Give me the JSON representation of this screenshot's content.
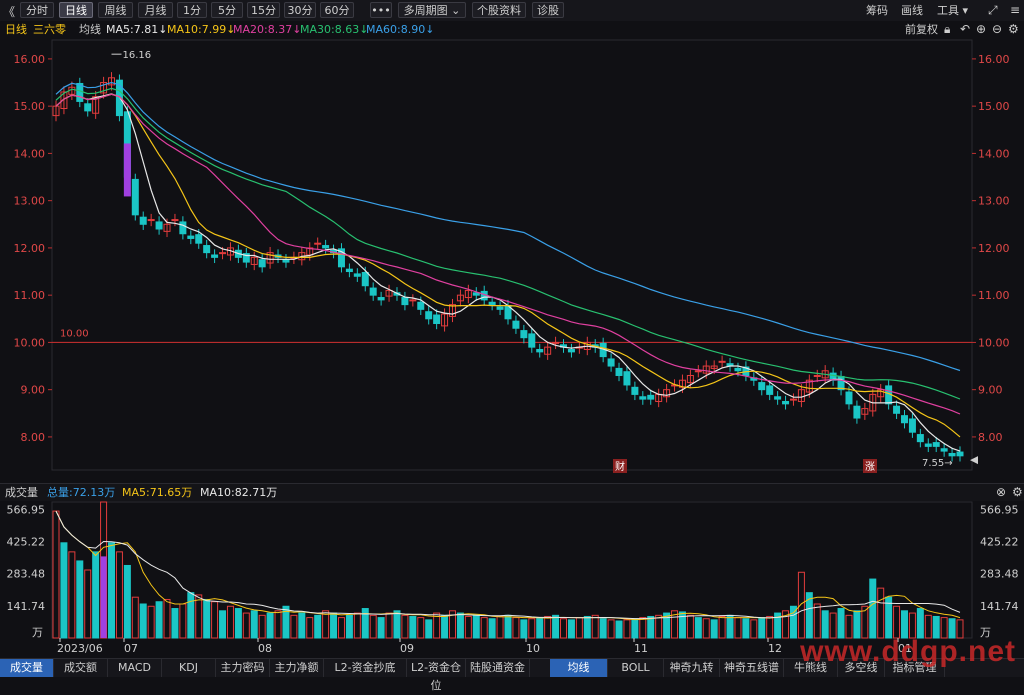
{
  "toolbar": {
    "collapse_icon": "《",
    "periods": [
      "分时",
      "日线",
      "周线",
      "月线",
      "1分",
      "5分",
      "15分",
      "30分",
      "60分",
      "•••",
      "多周期图 ⌄",
      "个股资料",
      "诊股"
    ],
    "active_period": "日线",
    "right": {
      "chips": "筹码",
      "draw": "画线",
      "tools": "工具 ▾"
    },
    "accent": "#2b63b5"
  },
  "stock": {
    "period_label": "日线",
    "name": "三六零",
    "ma_label": "均线",
    "ma": [
      {
        "name": "MA5",
        "value": "7.81",
        "color": "#e8e8e8"
      },
      {
        "name": "MA10",
        "value": "7.99",
        "color": "#f5c518"
      },
      {
        "name": "MA20",
        "value": "8.37",
        "color": "#e040a0"
      },
      {
        "name": "MA30",
        "value": "8.63",
        "color": "#28c070"
      },
      {
        "name": "MA60",
        "value": "8.90",
        "color": "#3aa0e8"
      }
    ],
    "adjust": "前复权"
  },
  "price_axis": {
    "ticks": [
      "16.00",
      "15.00",
      "14.00",
      "13.00",
      "12.00",
      "11.00",
      "10.00",
      "9.00",
      "8.00"
    ]
  },
  "annotations": {
    "high": "16.16",
    "low": "7.55",
    "line_value": "10.00",
    "marker_fin": "财",
    "marker_up": "涨"
  },
  "volume": {
    "title": "成交量",
    "total": "总量:72.13万",
    "ma5": "MA5:71.65万",
    "ma10": "MA10:82.71万",
    "ticks": [
      "566.95",
      "425.22",
      "283.48",
      "141.74",
      "万"
    ]
  },
  "x_axis": {
    "labels": [
      "2023/06",
      "07",
      "08",
      "09",
      "10",
      "11",
      "12",
      "01"
    ]
  },
  "bottom_tabs": [
    "成交量",
    "成交额",
    "MACD",
    "KDJ",
    "主力密码",
    "主力净额",
    "L2-资金抄底",
    "L2-资金仓位",
    "陆股通资金",
    "均线",
    "BOLL",
    "神奇九转",
    "神奇五线谱",
    "牛熊线",
    "多空线",
    "指标管理"
  ],
  "watermark": "www.ddgp.net",
  "chart_data": {
    "type": "line",
    "note_type": "candlestick",
    "up_color": "#e23c3c",
    "down_color": "#1bc6c6",
    "ylim": [
      7.3,
      16.4
    ],
    "close": [
      15.0,
      15.3,
      15.4,
      15.1,
      14.9,
      15.2,
      15.5,
      15.6,
      14.8,
      13.5,
      12.7,
      12.5,
      12.6,
      12.4,
      12.5,
      12.6,
      12.3,
      12.2,
      12.1,
      11.9,
      11.8,
      11.9,
      12.0,
      11.8,
      11.7,
      11.8,
      11.6,
      11.9,
      11.8,
      11.7,
      11.8,
      11.9,
      12.0,
      12.1,
      12.0,
      11.9,
      11.6,
      11.5,
      11.4,
      11.2,
      11.0,
      10.9,
      11.1,
      11.0,
      10.8,
      10.9,
      10.7,
      10.5,
      10.4,
      10.6,
      10.8,
      11.0,
      11.1,
      11.0,
      10.9,
      10.8,
      10.7,
      10.5,
      10.3,
      10.1,
      9.9,
      9.8,
      9.9,
      10.0,
      9.9,
      9.8,
      9.9,
      10.0,
      9.9,
      9.7,
      9.5,
      9.3,
      9.1,
      8.9,
      8.8,
      8.8,
      8.9,
      9.0,
      9.1,
      9.2,
      9.3,
      9.4,
      9.5,
      9.5,
      9.6,
      9.5,
      9.4,
      9.3,
      9.2,
      9.0,
      8.9,
      8.8,
      8.7,
      8.8,
      9.0,
      9.2,
      9.3,
      9.4,
      9.2,
      9.0,
      8.7,
      8.4,
      8.6,
      8.9,
      9.0,
      8.7,
      8.5,
      8.3,
      8.1,
      7.9,
      7.8,
      7.8,
      7.7,
      7.6,
      7.6
    ],
    "ma5": "7.81",
    "ma10": "7.99",
    "ma20": "8.37",
    "ma30": "8.63",
    "ma60": "8.90",
    "volume_ylim": [
      0,
      600
    ],
    "volume": [
      560,
      420,
      380,
      340,
      300,
      380,
      600,
      420,
      380,
      320,
      180,
      150,
      140,
      160,
      170,
      130,
      150,
      200,
      190,
      170,
      160,
      120,
      140,
      130,
      110,
      120,
      100,
      110,
      120,
      140,
      100,
      110,
      90,
      100,
      120,
      110,
      90,
      100,
      110,
      130,
      100,
      90,
      110,
      120,
      100,
      95,
      90,
      80,
      110,
      100,
      120,
      110,
      95,
      100,
      90,
      85,
      95,
      100,
      90,
      80,
      85,
      90,
      95,
      100,
      85,
      80,
      90,
      95,
      100,
      85,
      80,
      75,
      80,
      85,
      90,
      95,
      100,
      110,
      120,
      115,
      100,
      90,
      85,
      80,
      95,
      100,
      90,
      85,
      80,
      90,
      95,
      110,
      120,
      140,
      290,
      200,
      150,
      120,
      110,
      130,
      100,
      120,
      140,
      260,
      220,
      180,
      140,
      120,
      110,
      130,
      100,
      95,
      90,
      85,
      80
    ]
  }
}
